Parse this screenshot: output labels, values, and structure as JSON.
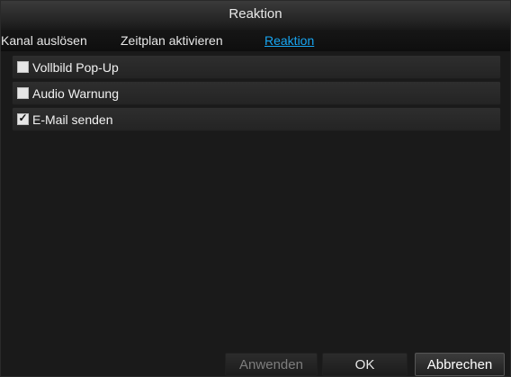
{
  "dialog": {
    "title": "Reaktion"
  },
  "tabs": [
    {
      "label": "Kanal auslösen",
      "active": false
    },
    {
      "label": "Zeitplan aktivieren",
      "active": false
    },
    {
      "label": "Reaktion",
      "active": true
    }
  ],
  "options": [
    {
      "label": "Vollbild Pop-Up",
      "checked": false
    },
    {
      "label": "Audio Warnung",
      "checked": false
    },
    {
      "label": "E-Mail senden",
      "checked": true
    }
  ],
  "buttons": {
    "apply_label": "Anwenden",
    "ok_label": "OK",
    "cancel_label": "Abbrechen"
  },
  "colors": {
    "accent": "#18a6f2",
    "background": "#1a1a1a"
  }
}
